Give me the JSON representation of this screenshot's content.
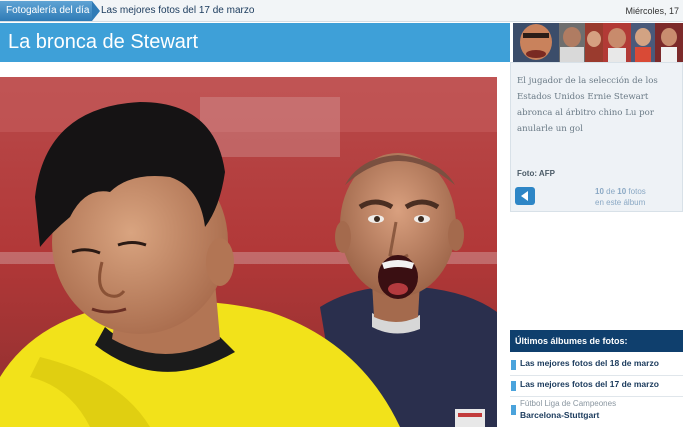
{
  "breadcrumb": {
    "section": "Fotogalería del día",
    "current": "Las mejores fotos del 17 de marzo"
  },
  "date": "Miércoles, 17",
  "title": "La bronca de Stewart",
  "caption": "El jugador de la selección de los Estados Unidos Ernie Stewart abronca al árbitro chino Lu por anularle un gol",
  "credit": "Foto: AFP",
  "counter": {
    "current": "10",
    "of": "de",
    "total": "10",
    "suffix": "fotos",
    "line2": "en este álbum"
  },
  "albums": {
    "heading": "Últimos álbumes de fotos:",
    "items": [
      {
        "label": "Las mejores fotos del 18 de marzo"
      },
      {
        "label": "Las mejores fotos del 17 de marzo"
      },
      {
        "sub": "Fútbol Liga de Campeones",
        "label": "Barcelona-Stuttgart"
      }
    ]
  },
  "colors": {
    "accent": "#3ea0d8",
    "dark_blue": "#0f3f6d",
    "referee_yellow": "#f2e21a"
  }
}
